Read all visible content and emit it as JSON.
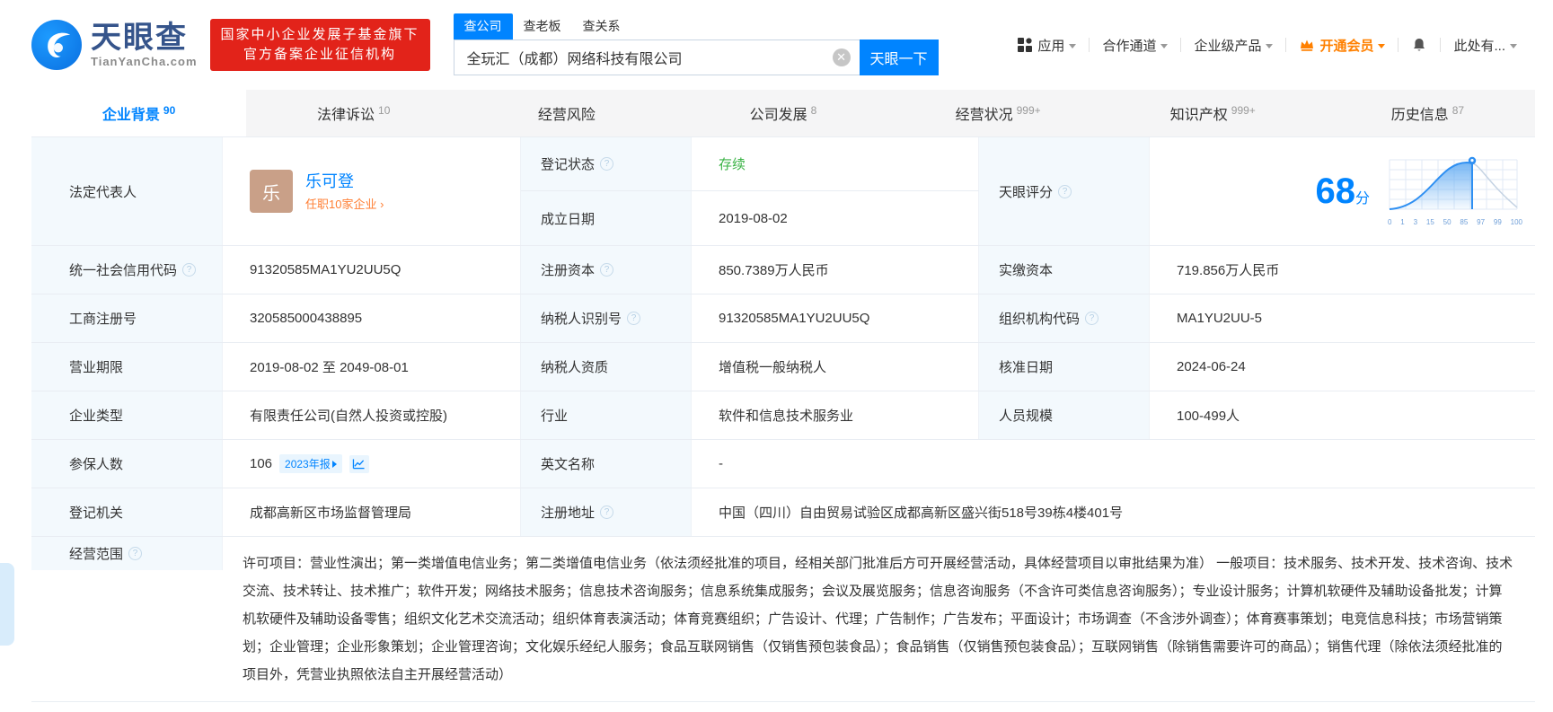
{
  "colors": {
    "accent": "#0084ff",
    "vip_orange": "#ff8000",
    "link_orange": "#ff7e33",
    "status_green": "#3bb346",
    "badge_red": "#e2231a",
    "avatar_bg": "#c9a088"
  },
  "header": {
    "logo": {
      "brand": "天眼查",
      "domain": "TianYanCha.com"
    },
    "badge": {
      "line1": "国家中小企业发展子基金旗下",
      "line2": "官方备案企业征信机构"
    },
    "search": {
      "tabs": [
        "查公司",
        "查老板",
        "查关系"
      ],
      "value": "全玩汇（成都）网络科技有限公司",
      "button": "天眼一下"
    },
    "menu": {
      "apps": "应用",
      "partner": "合作通道",
      "enterprise": "企业级产品",
      "vip": "开通会员",
      "more": "此处有..."
    }
  },
  "nav_tabs": [
    {
      "label": "企业背景",
      "count": "90"
    },
    {
      "label": "法律诉讼",
      "count": "10"
    },
    {
      "label": "经营风险",
      "count": ""
    },
    {
      "label": "公司发展",
      "count": "8"
    },
    {
      "label": "经营状况",
      "count": "999+"
    },
    {
      "label": "知识产权",
      "count": "999+"
    },
    {
      "label": "历史信息",
      "count": "87"
    }
  ],
  "profile": {
    "legal_rep": {
      "label": "法定代表人",
      "avatar": "乐",
      "name": "乐可登",
      "positions": "任职10家企业 ›"
    },
    "reg_status": {
      "label": "登记状态",
      "value": "存续"
    },
    "establish_date": {
      "label": "成立日期",
      "value": "2019-08-02"
    },
    "score": {
      "label": "天眼评分",
      "value": "68",
      "unit": "分",
      "ticks": [
        "0",
        "1",
        "3",
        "15",
        "50",
        "85",
        "97",
        "99",
        "100"
      ]
    },
    "credit_code": {
      "label": "统一社会信用代码",
      "value": "91320585MA1YU2UU5Q"
    },
    "reg_capital": {
      "label": "注册资本",
      "value": "850.7389万人民币"
    },
    "paid_capital": {
      "label": "实缴资本",
      "value": "719.856万人民币"
    },
    "reg_number": {
      "label": "工商注册号",
      "value": "320585000438895"
    },
    "taxpayer_id": {
      "label": "纳税人识别号",
      "value": "91320585MA1YU2UU5Q"
    },
    "org_code": {
      "label": "组织机构代码",
      "value": "MA1YU2UU-5"
    },
    "business_term": {
      "label": "营业期限",
      "value": "2019-08-02 至 2049-08-01"
    },
    "taxpayer_quality": {
      "label": "纳税人资质",
      "value": "增值税一般纳税人"
    },
    "approval_date": {
      "label": "核准日期",
      "value": "2024-06-24"
    },
    "company_type": {
      "label": "企业类型",
      "value": "有限责任公司(自然人投资或控股)"
    },
    "industry": {
      "label": "行业",
      "value": "软件和信息技术服务业"
    },
    "staff_size": {
      "label": "人员规模",
      "value": "100-499人"
    },
    "insured": {
      "label": "参保人数",
      "value": "106",
      "chip": "2023年报"
    },
    "english_name": {
      "label": "英文名称",
      "value": "-"
    },
    "reg_authority": {
      "label": "登记机关",
      "value": "成都高新区市场监督管理局"
    },
    "reg_address": {
      "label": "注册地址",
      "value": "中国（四川）自由贸易试验区成都高新区盛兴街518号39栋4楼401号"
    },
    "business_scope": {
      "label": "经营范围",
      "value": "许可项目：营业性演出；第一类增值电信业务；第二类增值电信业务（依法须经批准的项目，经相关部门批准后方可开展经营活动，具体经营项目以审批结果为准） 一般项目：技术服务、技术开发、技术咨询、技术交流、技术转让、技术推广；软件开发；网络技术服务；信息技术咨询服务；信息系统集成服务；会议及展览服务；信息咨询服务（不含许可类信息咨询服务）；专业设计服务；计算机软硬件及辅助设备批发；计算机软硬件及辅助设备零售；组织文化艺术交流活动；组织体育表演活动；体育竞赛组织；广告设计、代理；广告制作；广告发布；平面设计；市场调查（不含涉外调查）；体育赛事策划；电竞信息科技；市场营销策划；企业管理；企业形象策划；企业管理咨询；文化娱乐经纪人服务；食品互联网销售（仅销售预包装食品）；食品销售（仅销售预包装食品）；互联网销售（除销售需要许可的商品）；销售代理（除依法须经批准的项目外，凭营业执照依法自主开展经营活动）"
    }
  }
}
